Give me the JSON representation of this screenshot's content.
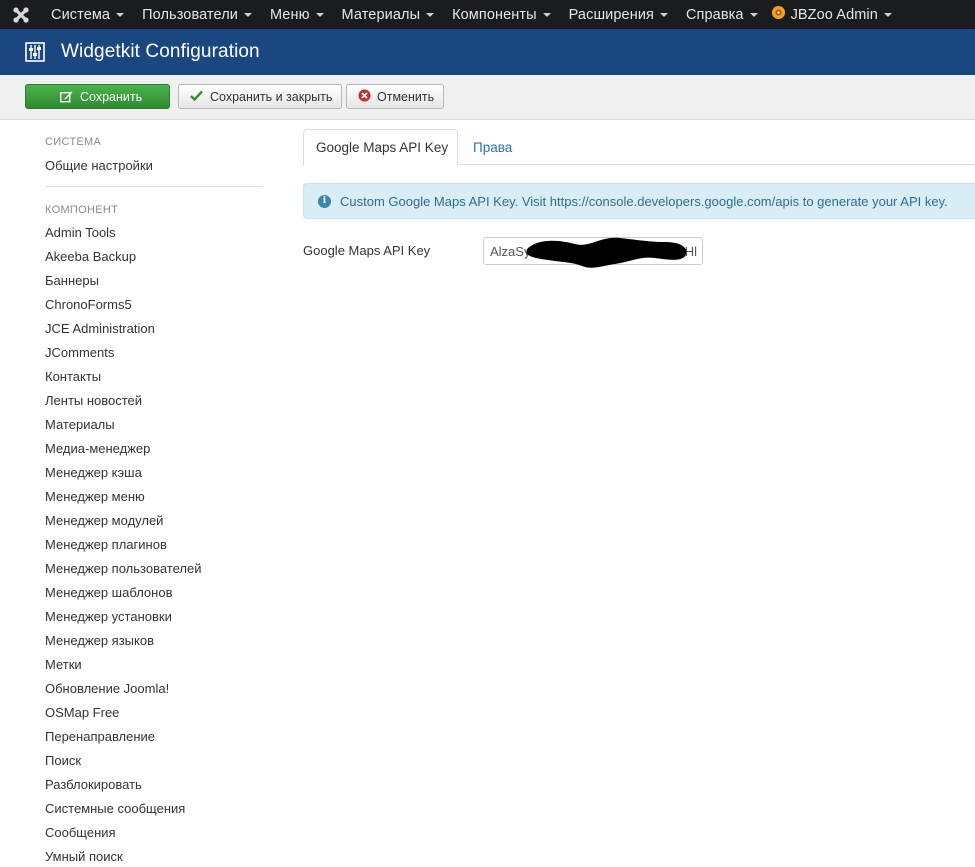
{
  "navbar": {
    "menus": [
      {
        "label": "Система"
      },
      {
        "label": "Пользователи"
      },
      {
        "label": "Меню"
      },
      {
        "label": "Материалы"
      },
      {
        "label": "Компоненты"
      },
      {
        "label": "Расширения"
      },
      {
        "label": "Справка"
      }
    ],
    "jbzoo_label": "JBZoo Admin"
  },
  "header": {
    "title": "Widgetkit Configuration"
  },
  "toolbar": {
    "save_label": "Сохранить",
    "save_close_label": "Сохранить и закрыть",
    "cancel_label": "Отменить"
  },
  "sidebar": {
    "system_heading": "СИСТЕМА",
    "system_items": [
      "Общие настройки"
    ],
    "component_heading": "КОМПОНЕНТ",
    "component_items": [
      "Admin Tools",
      "Akeeba Backup",
      "Баннеры",
      "ChronoForms5",
      "JCE Administration",
      "JComments",
      "Контакты",
      "Ленты новостей",
      "Материалы",
      "Медиа-менеджер",
      "Менеджер кэша",
      "Менеджер меню",
      "Менеджер модулей",
      "Менеджер плагинов",
      "Менеджер пользователей",
      "Менеджер шаблонов",
      "Менеджер установки",
      "Менеджер языков",
      "Метки",
      "Обновление Joomla!",
      "OSMap Free",
      "Перенаправление",
      "Поиск",
      "Разблокировать",
      "Системные сообщения",
      "Сообщения",
      "Умный поиск"
    ]
  },
  "tabs": [
    {
      "label": "Google Maps API Key",
      "active": true
    },
    {
      "label": "Права",
      "active": false
    }
  ],
  "alert": {
    "text": "Custom Google Maps API Key. Visit https://console.developers.google.com/apis to generate your API key."
  },
  "form": {
    "api_key_label": "Google Maps API Key",
    "api_key_value_start": "AlzaSy",
    "api_key_value_end": "Hl"
  },
  "colors": {
    "navbar_bg": "#1a1c1f",
    "header_bg": "#1b4780",
    "save_green": "#2f8a31",
    "link_blue": "#2a6fb5",
    "alert_bg": "#d9edf7"
  }
}
